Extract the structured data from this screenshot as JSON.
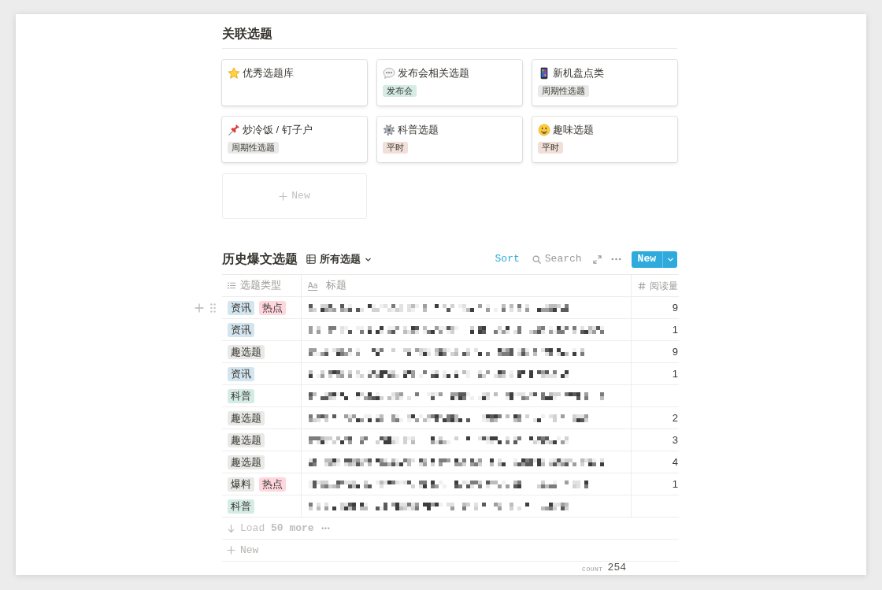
{
  "related": {
    "title": "关联选题",
    "cards": [
      {
        "kind": "star",
        "title": "优秀选题库"
      },
      {
        "kind": "speech-bubble",
        "title": "发布会相关选题",
        "tags": [
          {
            "label": "发布会",
            "color": "#d4ece5"
          }
        ]
      },
      {
        "kind": "phone",
        "title": "新机盘点类",
        "tags": [
          {
            "label": "周期性选题",
            "color": "#e9e9e7"
          }
        ]
      },
      {
        "kind": "pushpin",
        "title": "炒冷饭 / 钉子户",
        "tags": [
          {
            "label": "周期性选题",
            "color": "#e9e9e7"
          }
        ]
      },
      {
        "kind": "gear",
        "title": "科普选题",
        "tags": [
          {
            "label": "平时",
            "color": "#f1e0d9"
          }
        ]
      },
      {
        "kind": "smiley",
        "title": "趣味选题",
        "tags": [
          {
            "label": "平时",
            "color": "#f1e0d9"
          }
        ]
      }
    ],
    "new_card": "New"
  },
  "database": {
    "title": "历史爆文选题",
    "view": "所有选题",
    "sort": "Sort",
    "search": "Search",
    "new_button": "New",
    "columns": [
      {
        "kind": "select",
        "label": "选题类型"
      },
      {
        "kind": "title",
        "glyph": "Aa",
        "label": "标题"
      },
      {
        "kind": "number",
        "label": "阅读量"
      }
    ],
    "rows": [
      {
        "hovered": true,
        "tags": [
          {
            "label": "资讯",
            "color": "#d3e5ef"
          },
          {
            "label": "热点",
            "color": "#ffd6dd"
          }
        ],
        "reads": "9"
      },
      {
        "hovered": false,
        "tags": [
          {
            "label": "资讯",
            "color": "#d3e5ef"
          }
        ],
        "reads": "1"
      },
      {
        "hovered": false,
        "tags": [
          {
            "label": "趣选题",
            "color": "#e9e9e7"
          }
        ],
        "reads": "9"
      },
      {
        "hovered": false,
        "tags": [
          {
            "label": "资讯",
            "color": "#d3e5ef"
          }
        ],
        "reads": "1"
      },
      {
        "hovered": false,
        "tags": [
          {
            "label": "科普",
            "color": "#d4ece5"
          }
        ]
      },
      {
        "hovered": false,
        "tags": [
          {
            "label": "趣选题",
            "color": "#e9e9e7"
          }
        ],
        "reads": "2"
      },
      {
        "hovered": false,
        "tags": [
          {
            "label": "趣选题",
            "color": "#e9e9e7"
          }
        ],
        "reads": "3"
      },
      {
        "hovered": false,
        "tags": [
          {
            "label": "趣选题",
            "color": "#e9e9e7"
          }
        ],
        "reads": "4"
      },
      {
        "hovered": false,
        "tags": [
          {
            "label": "爆料",
            "color": "#e9e9e7"
          },
          {
            "label": "热点",
            "color": "#ffd6dd"
          }
        ],
        "reads": "1"
      },
      {
        "hovered": false,
        "tags": [
          {
            "label": "科普",
            "color": "#d4ece5"
          }
        ]
      }
    ],
    "load_more": "Load **50 more**",
    "new_row": "New",
    "count_label": "COUNT",
    "count": "254"
  }
}
